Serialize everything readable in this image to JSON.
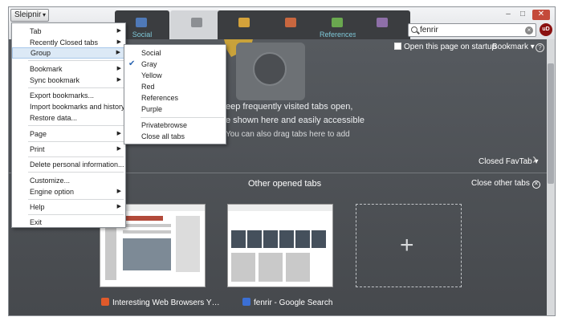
{
  "app_button": {
    "label": "Sleipnir"
  },
  "tabs": [
    {
      "label": "Social",
      "icon": "social-group-icon",
      "color": "#4f79b8"
    },
    {
      "label": "",
      "icon": "gray-group-icon",
      "color": "#8c8f93"
    },
    {
      "label": "",
      "icon": "yellow-group-icon",
      "color": "#d4a23a"
    },
    {
      "label": "",
      "icon": "red-group-icon",
      "color": "#c9673f"
    },
    {
      "label": "References",
      "icon": "references-group-icon",
      "color": "#6aa84f"
    },
    {
      "label": "",
      "icon": "purple-group-icon",
      "color": "#8e6fa8"
    }
  ],
  "search": {
    "value": "fenrir"
  },
  "toolbar": {
    "open_startup_label": "Open this page on startup",
    "bookmark_label": "Bookmark"
  },
  "empty_message": {
    "line1": "eep frequently visited tabs open,",
    "line2": "e shown here and easily accessible",
    "line3": "You can also drag tabs here to add"
  },
  "closed_favtab_label": "Closed FavTab",
  "other_tabs": {
    "title": "Other opened tabs",
    "close_label": "Close other tabs",
    "items": [
      {
        "caption": "Interesting Web Browsers Y…",
        "favicon_color": "#e05a2b"
      },
      {
        "caption": "fenrir - Google Search",
        "favicon_color": "#3b6fd4"
      }
    ]
  },
  "main_menu": {
    "items": [
      {
        "label": "Tab",
        "submenu": true
      },
      {
        "label": "Recently Closed tabs",
        "submenu": true
      },
      {
        "label": "Group",
        "submenu": true
      },
      {
        "label": "Bookmark",
        "submenu": true
      },
      {
        "label": "Sync bookmark",
        "submenu": true
      },
      {
        "label": "Export bookmarks...",
        "submenu": false
      },
      {
        "label": "Import bookmarks and history...",
        "submenu": false
      },
      {
        "label": "Restore data...",
        "submenu": false
      },
      {
        "label": "Page",
        "submenu": true
      },
      {
        "label": "Print",
        "submenu": true
      },
      {
        "label": "Delete personal information...",
        "submenu": false
      },
      {
        "label": "Customize...",
        "submenu": false
      },
      {
        "label": "Engine option",
        "submenu": true
      },
      {
        "label": "Help",
        "submenu": true
      },
      {
        "label": "Exit",
        "submenu": false
      }
    ]
  },
  "group_menu": {
    "items": [
      {
        "label": "Social",
        "checked": false
      },
      {
        "label": "Gray",
        "checked": true
      },
      {
        "label": "Yellow",
        "checked": false
      },
      {
        "label": "Red",
        "checked": false
      },
      {
        "label": "References",
        "checked": false
      },
      {
        "label": "Purple",
        "checked": false
      },
      {
        "label": "Privatebrowse",
        "checked": false
      },
      {
        "label": "Close all tabs",
        "checked": false
      }
    ]
  },
  "colors": {
    "accent": "#2a64b0",
    "highlight": "#dce9f6",
    "close_button": "#c44a3a"
  }
}
